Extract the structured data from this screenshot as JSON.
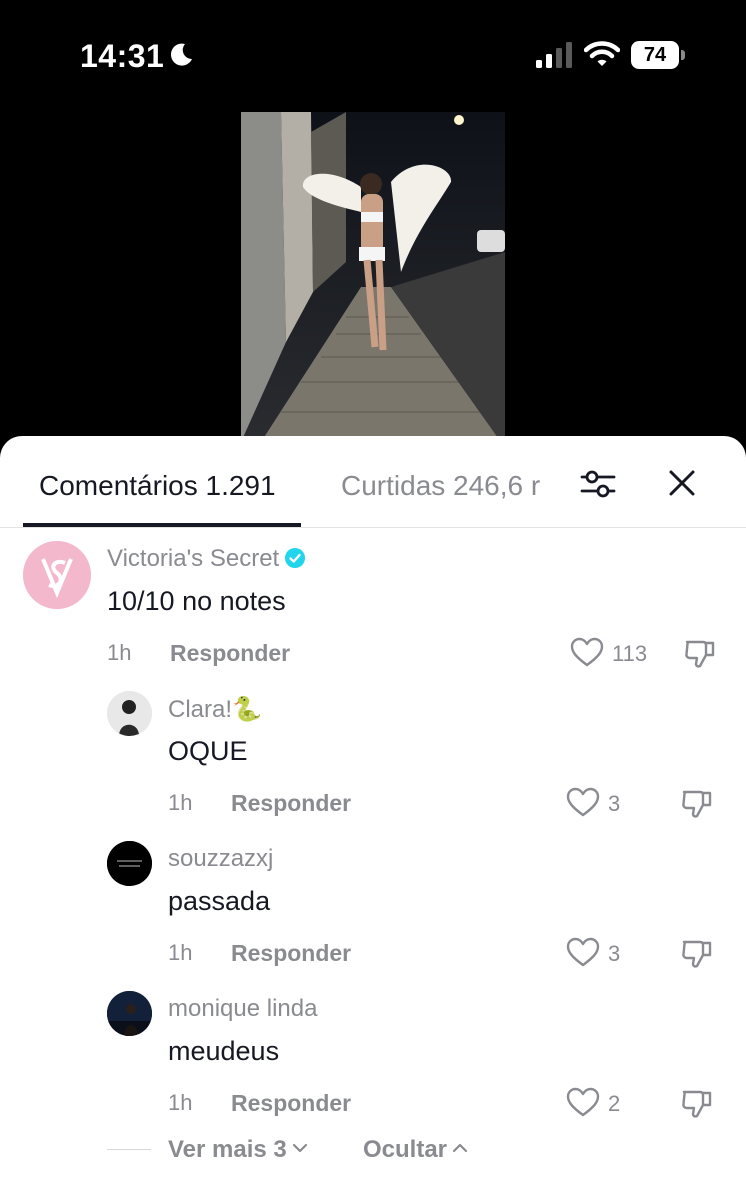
{
  "status_bar": {
    "time": "14:31",
    "battery": "74"
  },
  "sheet": {
    "tabs": {
      "comments_label": "Comentários 1.291",
      "likes_label": "Curtidas 246,6 r"
    },
    "comments": [
      {
        "username": "Victoria's Secret",
        "verified": true,
        "text": "10/10 no notes",
        "time": "1h",
        "reply_label": "Responder",
        "likes": "113"
      },
      {
        "username": "Clara!🐍",
        "text": "OQUE",
        "time": "1h",
        "reply_label": "Responder",
        "likes": "3"
      },
      {
        "username": "souzzazxj",
        "text": "passada",
        "time": "1h",
        "reply_label": "Responder",
        "likes": "3"
      },
      {
        "username": "monique linda",
        "text": "meudeus",
        "time": "1h",
        "reply_label": "Responder",
        "likes": "2"
      }
    ],
    "view_more_label": "Ver mais 3",
    "hide_label": "Ocultar"
  },
  "colors": {
    "text_primary": "#161823",
    "text_secondary": "#8a8b91",
    "verified": "#20d5ec",
    "vs_pink": "#f4b8cc"
  }
}
